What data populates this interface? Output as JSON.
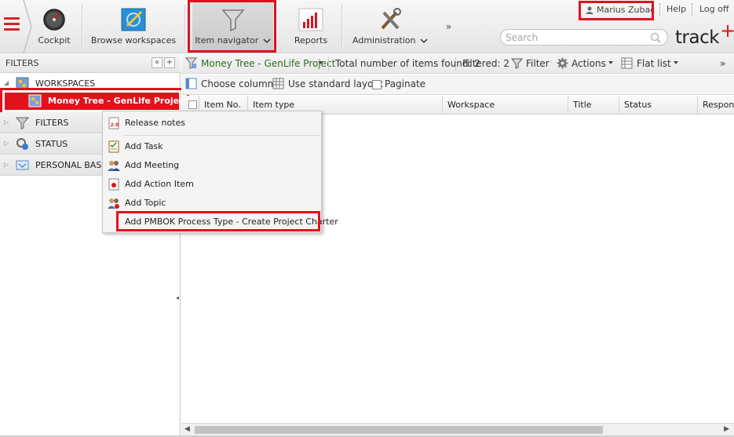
{
  "header": {
    "nav": [
      {
        "id": "cockpit",
        "label": "Cockpit",
        "icon": "speedometer-icon"
      },
      {
        "id": "browse",
        "label": "Browse workspaces",
        "icon": "workspaces-icon"
      },
      {
        "id": "navigator",
        "label": "Item navigator",
        "icon": "funnel-icon",
        "active": true
      },
      {
        "id": "reports",
        "label": "Reports",
        "icon": "bar-chart-icon"
      },
      {
        "id": "admin",
        "label": "Administration",
        "icon": "tools-icon"
      }
    ],
    "more": "»",
    "user_name": "Marius Zubac",
    "help_label": "Help",
    "logoff_label": "Log off",
    "search_placeholder": "Search",
    "logo_text": "track",
    "logo_plus": "+"
  },
  "left_panel": {
    "title": "FILTERS",
    "collapse_btn": "«",
    "add_btn": "+",
    "tree": [
      {
        "label": "WORKSPACES",
        "icon": "workspaces-icon",
        "expanded": true
      },
      {
        "label": "Money Tree - GenLife Project",
        "icon": "project-icon",
        "selected": true
      },
      {
        "label": "FILTERS",
        "icon": "funnel-icon"
      },
      {
        "label": "STATUS",
        "icon": "status-icon"
      },
      {
        "label": "PERSONAL BASKET",
        "icon": "basket-icon"
      }
    ],
    "handle": "◂"
  },
  "toolbar": {
    "workspace": "Money Tree - GenLife Project",
    "total_label": "Total number of items found: 2",
    "filtered_label": "Filtered: 2",
    "filter_label": "Filter",
    "actions_label": "Actions",
    "view_label": "Flat list",
    "more": "»",
    "choose_columns": "Choose columns",
    "standard_layout": "Use standard layout",
    "paginate": "Paginate"
  },
  "grid": {
    "columns": [
      "Item No.",
      "Item type",
      "Workspace",
      "Title",
      "Status",
      "Responsible"
    ]
  },
  "context_menu": {
    "items": [
      {
        "label": "Release notes",
        "icon": "release-notes-icon"
      },
      {
        "label": "Add Task",
        "icon": "task-icon"
      },
      {
        "label": "Add Meeting",
        "icon": "meeting-icon"
      },
      {
        "label": "Add Action Item",
        "icon": "action-item-icon"
      },
      {
        "label": "Add Topic",
        "icon": "topic-icon"
      },
      {
        "label": "Add PMBOK Process Type - Create Project Charter",
        "icon": ""
      }
    ]
  },
  "colors": {
    "accent_red": "#e0121c",
    "workspace_green": "#2d6b1f",
    "selected_bg": "#e0121c"
  }
}
